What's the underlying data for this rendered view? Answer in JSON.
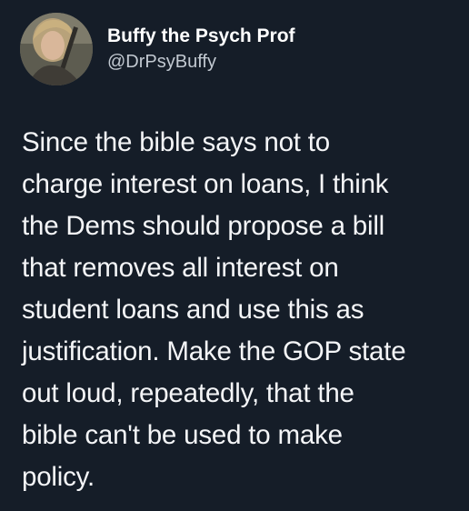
{
  "author": {
    "display_name": "Buffy the Psych Prof",
    "handle": "@DrPsyBuffy"
  },
  "tweet": {
    "lines": [
      "Since the bible says not to",
      "charge interest on loans, I think",
      "the Dems should propose a bill",
      "that removes all interest on",
      "student loans and use this as",
      "justification. Make the GOP state",
      "out loud, repeatedly, that the",
      "bible can't be used to make",
      "policy."
    ]
  },
  "colors": {
    "background": "#151d28",
    "text": "#f4f5f7",
    "handle": "#c2c9d1"
  }
}
